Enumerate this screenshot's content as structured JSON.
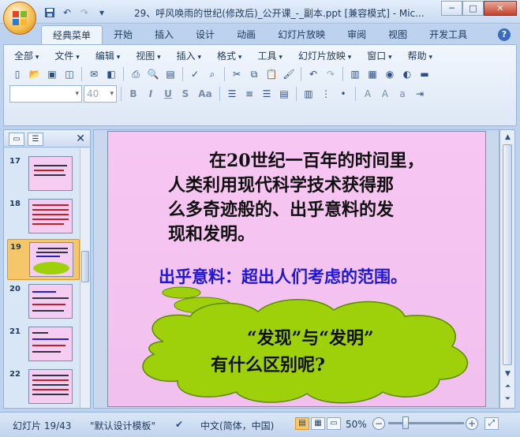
{
  "window": {
    "title": "29、呼风唤雨的世纪(修改后)_公开课_-_副本.ppt [兼容模式] - Mic...",
    "controls": {
      "minimize": "─",
      "maximize": "□",
      "close": "✕"
    }
  },
  "quick_access": {
    "save": "save-icon",
    "undo": "↶",
    "redo": "↷",
    "more": "▾"
  },
  "tabs": [
    "经典菜单",
    "开始",
    "插入",
    "设计",
    "动画",
    "幻灯片放映",
    "审阅",
    "视图",
    "开发工具"
  ],
  "active_tab": "经典菜单",
  "help_label": "?",
  "menus": [
    "全部",
    "文件",
    "编辑",
    "视图",
    "插入",
    "格式",
    "工具",
    "幻灯片放映",
    "窗口",
    "帮助"
  ],
  "font_combo": {
    "value": ""
  },
  "size_combo": {
    "value": "40"
  },
  "format_buttons": {
    "bold": "B",
    "italic": "I",
    "underline": "U",
    "strike": "S",
    "case": "Aa"
  },
  "outline_pane": {
    "tab_slides": "▭",
    "tab_outline": "☰",
    "close": "✕",
    "thumbnails": [
      {
        "number": "17"
      },
      {
        "number": "18"
      },
      {
        "number": "19"
      },
      {
        "number": "20"
      },
      {
        "number": "21"
      },
      {
        "number": "22"
      }
    ],
    "selected": "19"
  },
  "slide": {
    "main_text": "在20世纪一百年的时间里，人类利用现代科学技术获得那么多奇迹般的、出乎意料的发现和发明。",
    "main_lines": [
      "在20世纪一百年的时间里，",
      "人类利用现代科学技术获得那",
      "么多奇迹般的、出乎意料的发",
      "现和发明。"
    ],
    "subtitle": "出乎意料：超出人们考虑的范围。",
    "cloud_line1": "“发现”与“发明”",
    "cloud_line2": "有什么区别呢?",
    "colors": {
      "background": "#f7c6f2",
      "subtitle": "#1d17d4",
      "cloud": "#9ed10a"
    }
  },
  "status": {
    "slide_count": "幻灯片 19/43",
    "template": "\"默认设计模板\"",
    "language": "中文(简体，中国)",
    "zoom": "50%",
    "zoom_minus": "−",
    "zoom_plus": "+"
  }
}
